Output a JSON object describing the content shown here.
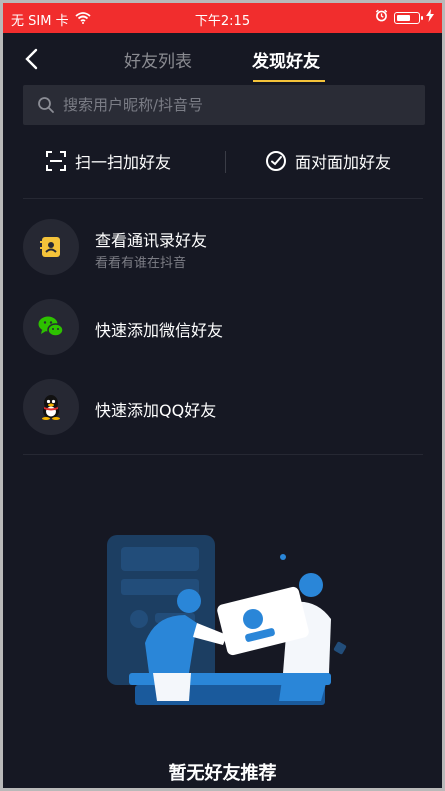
{
  "status_bar": {
    "carrier": "无 SIM 卡",
    "time": "下午2:15",
    "battery_level": 0.7
  },
  "nav": {
    "tabs": [
      {
        "label": "好友列表",
        "active": false
      },
      {
        "label": "发现好友",
        "active": true
      }
    ]
  },
  "search": {
    "placeholder": "搜索用户昵称/抖音号",
    "value": ""
  },
  "quick_actions": {
    "scan_label": "扫一扫加好友",
    "face_label": "面对面加好友"
  },
  "list": {
    "contacts_title": "查看通讯录好友",
    "contacts_subtitle": "看看有谁在抖音",
    "wechat_title": "快速添加微信好友",
    "qq_title": "快速添加QQ好友"
  },
  "empty_state": {
    "text": "暂无好友推荐"
  },
  "colors": {
    "background": "#161823",
    "status_bar": "#f12d2d",
    "accent_underline": "#f4c33a",
    "wechat_green": "#2dc100",
    "illustration_blue": "#2a86d8"
  }
}
